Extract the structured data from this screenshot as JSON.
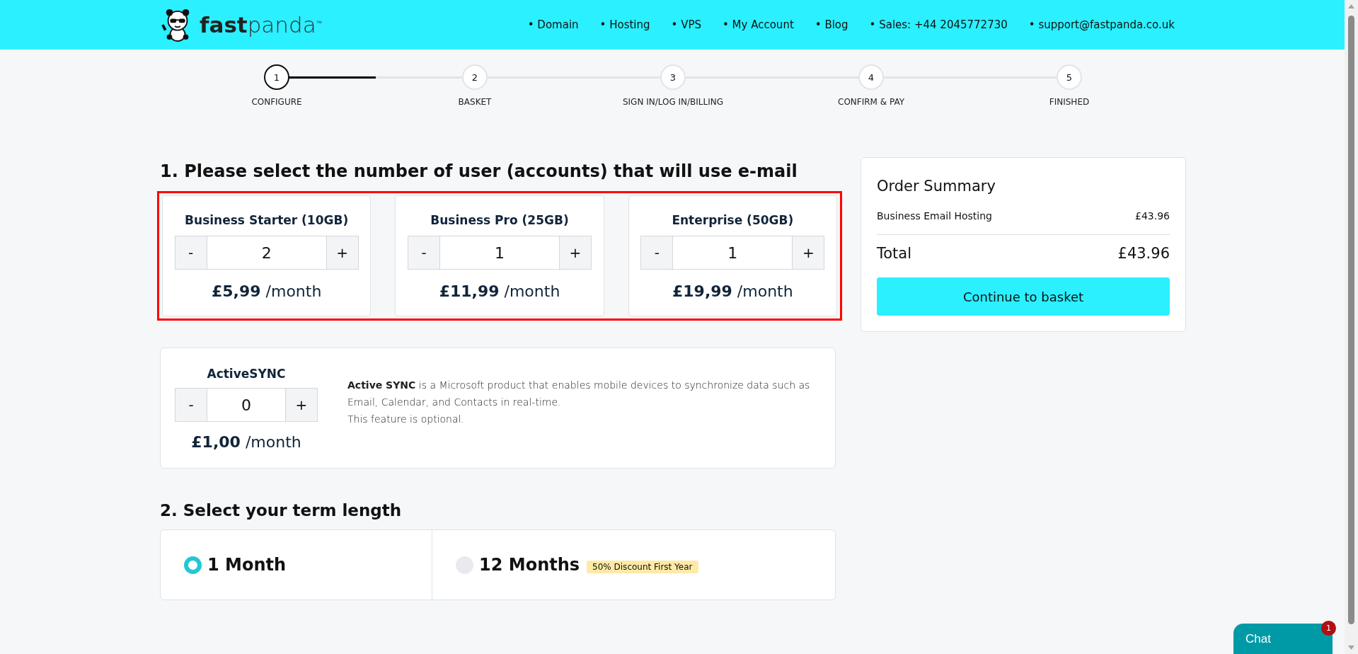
{
  "header": {
    "logo": "**fast**panda$^{™}$",
    "nav": [
      {
        "label": "• Domain"
      },
      {
        "label": "• Hosting"
      },
      {
        "label": "• VPS"
      },
      {
        "label": "• My Account"
      },
      {
        "label": "• Blog"
      },
      {
        "label": "• Sales:  +44 2045772730"
      },
      {
        "label": "• support@fastpanda.co.uk"
      }
    ]
  },
  "stepper": {
    "steps": [
      {
        "number": "1",
        "label": "CONFIGURE",
        "selected": true,
        "level": 0.5
      },
      {
        "number": "2",
        "label": "BASKET",
        "selected": false
      },
      {
        "number": "3",
        "label": "SIGN IN/LOG IN/BILLING",
        "selected": false
      },
      {
        "number": "4",
        "label": "CONFIRM & PAY",
        "selected": false
      },
      {
        "number": "5",
        "label": "FINISHED",
        "selected": false
      }
    ]
  },
  "section_1": {
    "heading": "1. Please select the number of user (accounts) that will use e-mail",
    "plans": [
      {
        "name": "Business Starter (10GB)",
        "decrement": "-",
        "quantity": "2",
        "increment": "+",
        "price": "**£5,99** /month"
      },
      {
        "name": "Business Pro (25GB)",
        "decrement": "-",
        "quantity": "1",
        "increment": "+",
        "price": "**£11,99** /month"
      },
      {
        "name": "Enterprise (50GB)",
        "decrement": "-",
        "quantity": "1",
        "increment": "+",
        "price": "**£19,99** /month"
      }
    ],
    "addon": {
      "name": "ActiveSYNC",
      "decrement": "-",
      "quantity": "0",
      "increment": "+",
      "price": "**£1,00** /month",
      "description": [
        "**Active SYNC** is a Microsoft product that enables mobile devices to synchronize data such as Email, Calendar, and Contacts in real-time.",
        "This feature is optional."
      ]
    }
  },
  "section_2": {
    "heading": "2. Select your term length",
    "options": [
      {
        "label": "1 Month",
        "selected": true
      },
      {
        "label": "12 Months",
        "selected": false,
        "badge": "50% Discount First Year"
      }
    ]
  },
  "order_summary": {
    "title": "Order Summary",
    "items": [
      {
        "label": "Business Email Hosting",
        "amount": "£43.96"
      }
    ],
    "total_label": "Total",
    "total": "£43.96",
    "button": "Continue to basket"
  },
  "chat": {
    "label": "Chat",
    "badge": "1"
  }
}
